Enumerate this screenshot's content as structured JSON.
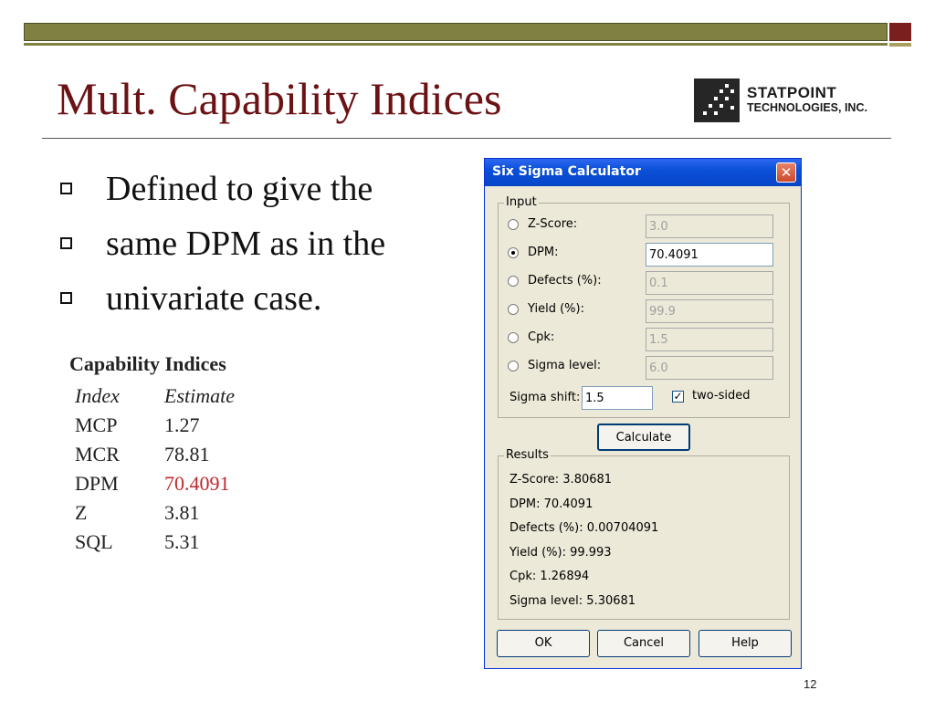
{
  "slide": {
    "title": "Mult. Capability Indices",
    "logo": {
      "line1": "STATPOINT",
      "line2": "TECHNOLOGIES, INC."
    },
    "bullets": [
      "Defined to give the",
      "same DPM as in the",
      "univariate case."
    ],
    "page_number": "12",
    "colors": {
      "title": "#6b1214",
      "highlight": "#c0282d",
      "bar_olive": "#808040",
      "bar_maroon": "#7a1e1e"
    }
  },
  "capability": {
    "title": "Capability Indices",
    "headers": [
      "Index",
      "Estimate"
    ],
    "rows": [
      [
        "MCP",
        "1.27"
      ],
      [
        "MCR",
        "78.81"
      ],
      [
        "DPM",
        "70.4091"
      ],
      [
        "Z",
        "3.81"
      ],
      [
        "SQL",
        "5.31"
      ]
    ]
  },
  "dialog": {
    "title": "Six Sigma Calculator",
    "close_glyph": "✕",
    "input_group_label": "Input",
    "inputs": [
      {
        "label": "Z-Score:",
        "value": "3.0",
        "selected": false
      },
      {
        "label": "DPM:",
        "value": "70.4091",
        "selected": true
      },
      {
        "label": "Defects (%):",
        "value": "0.1",
        "selected": false
      },
      {
        "label": "Yield (%):",
        "value": "99.9",
        "selected": false
      },
      {
        "label": "Cpk:",
        "value": "1.5",
        "selected": false
      },
      {
        "label": "Sigma level:",
        "value": "6.0",
        "selected": false
      }
    ],
    "sigma_shift_label": "Sigma shift:",
    "sigma_shift_value": "1.5",
    "two_sided_label": "two-sided",
    "two_sided_checked": true,
    "check_glyph": "✓",
    "calculate_label": "Calculate",
    "results_group_label": "Results",
    "results": [
      "Z-Score: 3.80681",
      "DPM: 70.4091",
      "Defects (%): 0.00704091",
      "Yield (%): 99.993",
      "Cpk: 1.26894",
      "Sigma level: 5.30681"
    ],
    "ok_label": "OK",
    "cancel_label": "Cancel",
    "help_label": "Help"
  }
}
